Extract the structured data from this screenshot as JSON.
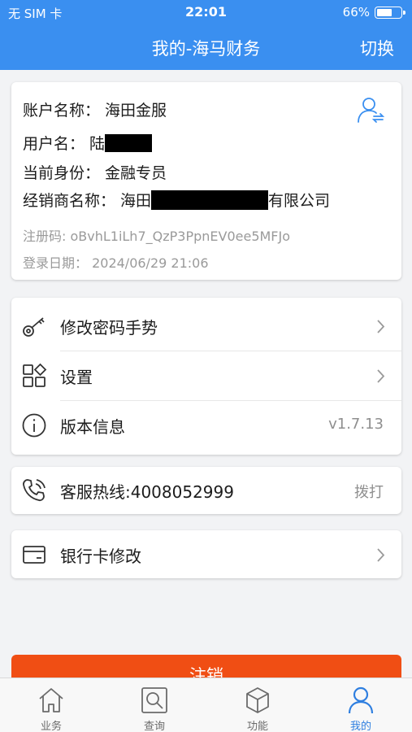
{
  "status_bar": {
    "carrier": "无 SIM 卡",
    "time": "22:01",
    "battery": "66%",
    "battery_level": 0.66
  },
  "nav": {
    "title": "我的-海马财务",
    "switch_label": "切换"
  },
  "account": {
    "account_name": "账户名称：  海田金服",
    "username_prefix": "用户名：  陆",
    "identity": "当前身份：  金融专员",
    "dealer_prefix": "经销商名称：  海田",
    "dealer_suffix": "有限公司",
    "reg_code": "注册码: oBvhL1iLh7_QzP3PpnEV0ee5MFJo",
    "login_date": "登录日期：  2024/06/29 21:06"
  },
  "menu": {
    "change_password": "修改密码手势",
    "settings": "设置",
    "version_label": "版本信息",
    "version_value": "v1.7.13"
  },
  "hotline": {
    "label": "客服热线:4008052999",
    "action": "拨打"
  },
  "bank": {
    "label": "银行卡修改"
  },
  "logout_label": "注销",
  "tabs": [
    {
      "label": "业务",
      "icon": "home-icon"
    },
    {
      "label": "查询",
      "icon": "search-icon"
    },
    {
      "label": "功能",
      "icon": "cube-icon"
    },
    {
      "label": "我的",
      "icon": "person-icon"
    }
  ],
  "colors": {
    "primary": "#3a8ff0",
    "danger": "#f04e14",
    "tab_active": "#2f7fe0"
  }
}
